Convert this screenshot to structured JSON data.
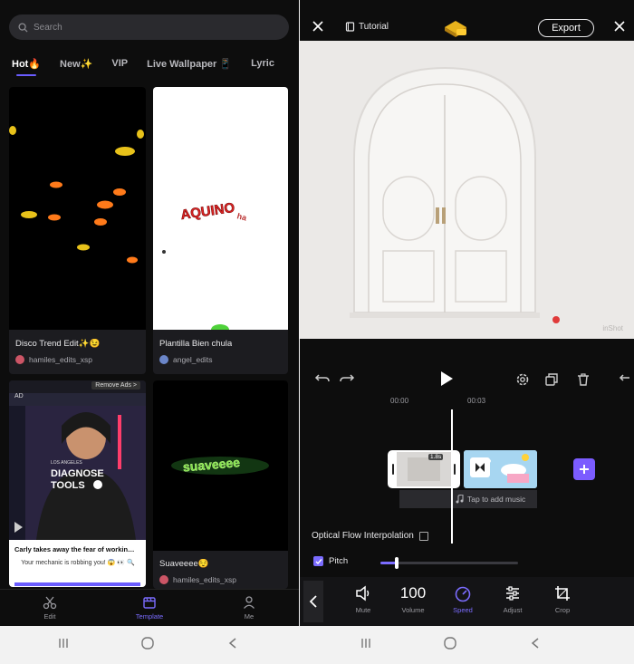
{
  "left": {
    "search_placeholder": "Search",
    "tabs": [
      "Hot🔥",
      "New✨",
      "VIP",
      "Live Wallpaper 📱",
      "Lyric"
    ],
    "active_tab": 0,
    "cards": [
      {
        "title": "Disco Trend Edit✨😉",
        "author": "hamiles_edits_xsp"
      },
      {
        "title": "Plantilla Bien chula",
        "author": "angel_edits"
      },
      {
        "title": "Suaveeee😌",
        "author": "hamiles_edits_xsp"
      }
    ],
    "thumb_texts": {
      "aquino": "AQUINO",
      "aquino_sub": "ha",
      "suaveeee": "suaveeee"
    },
    "ad": {
      "badge": "AD",
      "remove": "Remove Ads >",
      "brand": "LOS ANGELES",
      "headline_1": "DIAGNOSE",
      "headline_2": "TOOLS",
      "caption": "Carly takes away the fear of workin…",
      "subcaption": "Your mechanic is robbing you! 😱 👀 🔍"
    },
    "nav": [
      {
        "label": "Edit",
        "icon": "scissors-icon"
      },
      {
        "label": "Template",
        "icon": "template-icon"
      },
      {
        "label": "Me",
        "icon": "person-icon"
      }
    ],
    "active_nav": 1
  },
  "right": {
    "tutorial_label": "Tutorial",
    "export_label": "Export",
    "watermark": "inShot",
    "timecodes": [
      "00:00",
      "00:03"
    ],
    "audio_hint": "Tap to add music",
    "clip_duration": "1.8s",
    "optical_flow_label": "Optical Flow Interpolation",
    "pitch_label": "Pitch",
    "pitch_checked": true,
    "speed_fraction": 0.12,
    "tools": [
      {
        "label": "Mute",
        "icon": "speaker-icon"
      },
      {
        "label": "Volume",
        "value": "100"
      },
      {
        "label": "Speed",
        "icon": "speedometer-icon"
      },
      {
        "label": "Adjust",
        "icon": "sliders-icon"
      },
      {
        "label": "Crop",
        "icon": "crop-icon"
      }
    ],
    "active_tool": 2
  },
  "colors": {
    "accent": "#7b6cff",
    "add_button": "#7b5cff",
    "background": "#0d0d0d"
  }
}
